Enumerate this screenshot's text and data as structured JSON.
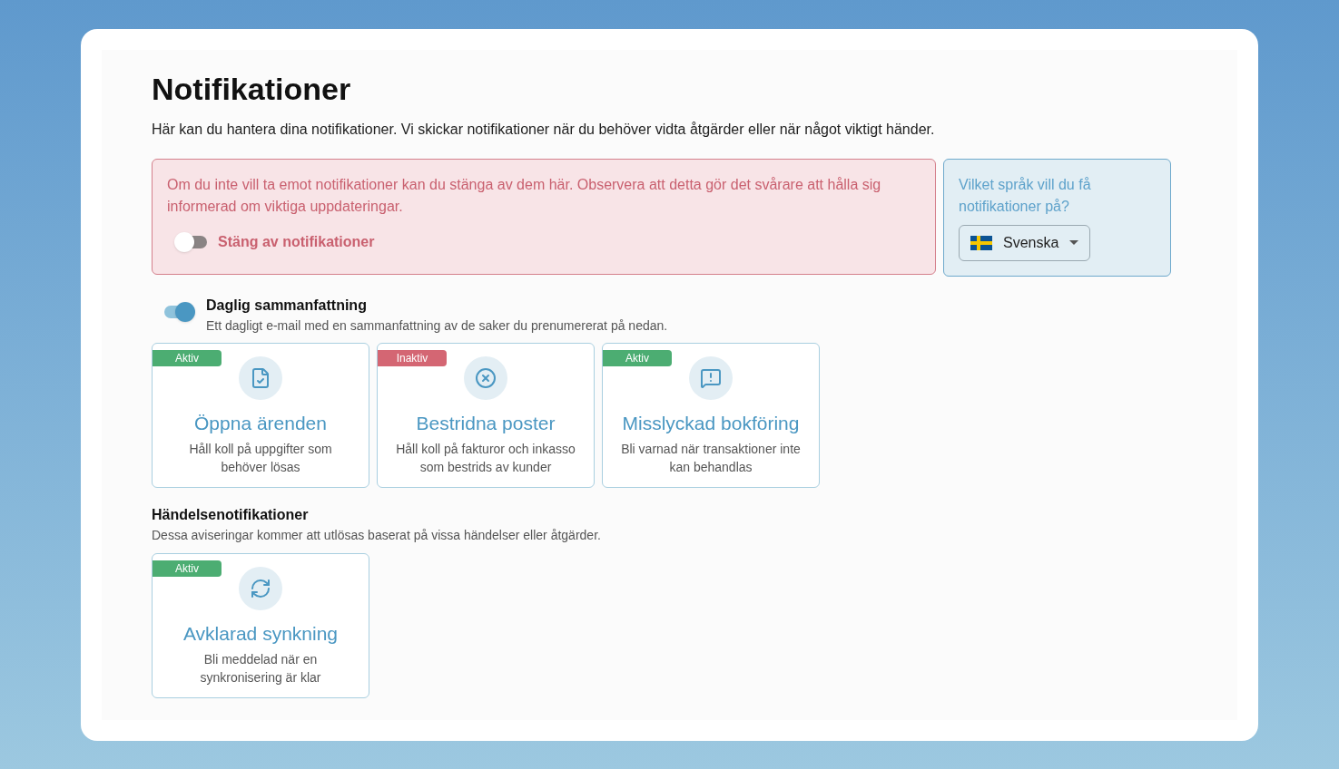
{
  "title": "Notifikationer",
  "intro": "Här kan du hantera dina notifikationer. Vi skickar notifikationer när du behöver vidta åtgärder eller när något viktigt händer.",
  "warning": {
    "text": "Om du inte vill ta emot notifikationer kan du stänga av dem här. Observera att detta gör det svårare att hålla sig informerad om viktiga uppdateringar.",
    "toggle": {
      "label": "Stäng av notifikationer",
      "on": false
    }
  },
  "language": {
    "question": "Vilket språk vill du få notifikationer på?",
    "value": "Svenska"
  },
  "daily": {
    "title": "Daglig sammanfattning",
    "description": "Ett dagligt e-mail med en sammanfattning av de saker du prenumererat på nedan.",
    "on": true
  },
  "daily_cards": [
    {
      "badge": "Aktiv",
      "active": true,
      "kind": "document",
      "title": "Öppna ärenden",
      "description": "Håll koll på uppgifter som behöver lösas"
    },
    {
      "badge": "Inaktiv",
      "active": false,
      "kind": "cancel",
      "title": "Bestridna poster",
      "description": "Håll koll på fakturor och inkasso som bestrids av kunder"
    },
    {
      "badge": "Aktiv",
      "active": true,
      "kind": "alert",
      "title": "Misslyckad bokföring",
      "description": "Bli varnad när transaktioner inte kan behandlas"
    }
  ],
  "events": {
    "title": "Händelsenotifikationer",
    "description": "Dessa aviseringar kommer att utlösas baserat på vissa händelser eller åtgärder.",
    "cards": [
      {
        "badge": "Aktiv",
        "active": true,
        "kind": "sync",
        "title": "Avklarad synkning",
        "description": "Bli meddelad när en synkronisering är klar"
      }
    ]
  }
}
